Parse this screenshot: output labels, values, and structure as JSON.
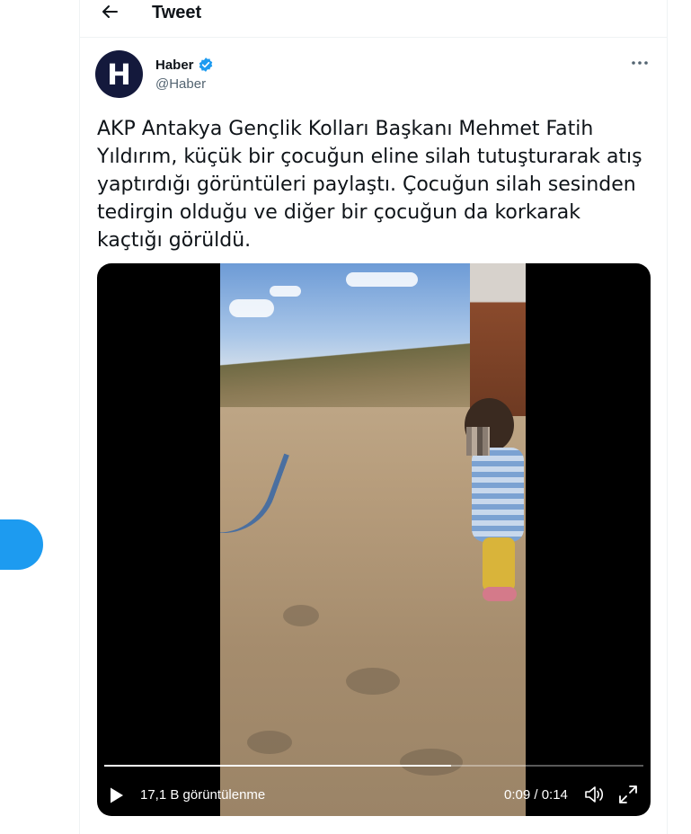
{
  "header": {
    "title": "Tweet"
  },
  "author": {
    "avatar_letter": "H",
    "name": "Haber",
    "handle": "@Haber",
    "verified": true
  },
  "tweet": {
    "lines": [
      "AKP Antakya Gençlik Kolları Başkanı Mehmet Fatih",
      "Yıldırım, küçük bir çocuğun eline silah tutuşturarak atış",
      "yaptırdığı görüntüleri paylaştı. Çocuğun silah sesinden",
      "tedirgin olduğu ve diğer bir çocuğun da korkarak",
      "kaçtığı görüldü."
    ]
  },
  "video": {
    "views": "17,1 B görüntülenme",
    "time": "0:09 / 0:14",
    "progress": 0.643
  },
  "colors": {
    "accent": "#1d9bf0",
    "avatar_bg": "#14193c",
    "secondary_text": "#536471"
  }
}
